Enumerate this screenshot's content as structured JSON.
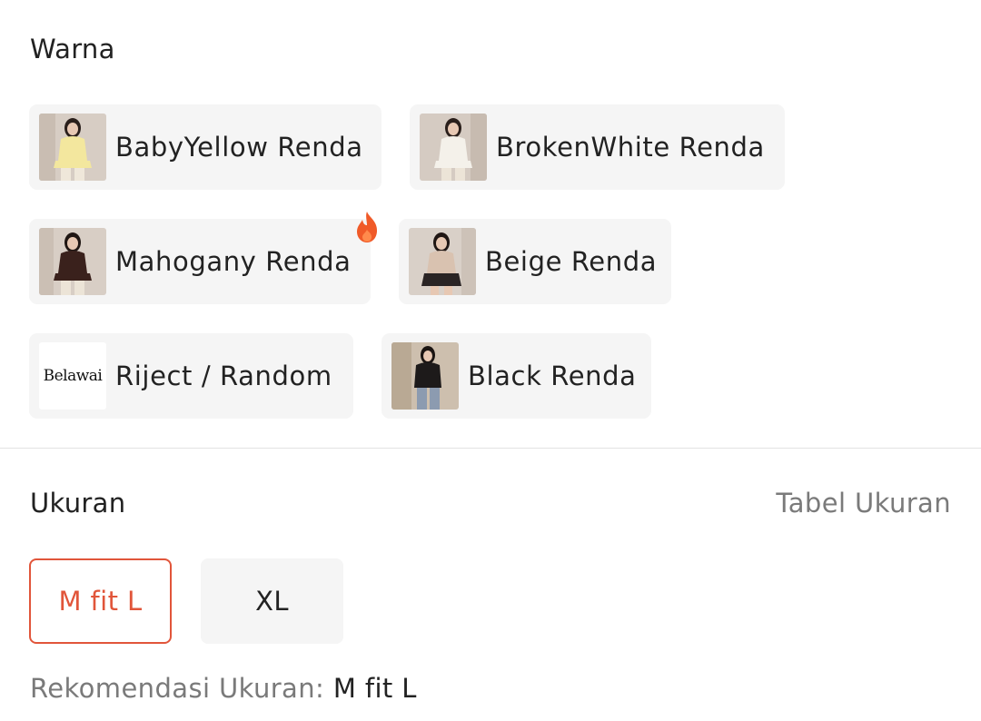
{
  "color_section": {
    "title": "Warna",
    "variants": [
      {
        "label": "BabyYellow Renda",
        "top_color": "#f3e79e",
        "bottom_color": "#efe7da",
        "hot": false
      },
      {
        "label": "BrokenWhite Renda",
        "top_color": "#f4f1ea",
        "bottom_color": "#ece4d7",
        "hot": false
      },
      {
        "label": "Mahogany Renda",
        "top_color": "#3a211c",
        "bottom_color": "#ece4d7",
        "hot": true
      },
      {
        "label": "Beige Renda",
        "top_color": "#d9c2b0",
        "bottom_color": "#2a2424",
        "hot": false
      },
      {
        "label": "Riject / Random",
        "logo_text": "Belawai",
        "hot": false
      },
      {
        "label": "Black Renda",
        "top_color": "#1d1a1a",
        "bottom_color": "#8c9bb0",
        "hot": false
      }
    ]
  },
  "size_section": {
    "title": "Ukuran",
    "size_chart_link": "Tabel Ukuran",
    "sizes": [
      {
        "label": "M fit L",
        "selected": true
      },
      {
        "label": "XL",
        "selected": false
      }
    ],
    "recommendation_label": "Rekomendasi Ukuran:",
    "recommendation_value": "M fit L"
  },
  "colors": {
    "accent": "#e1553a",
    "chip_bg": "#f5f5f5",
    "muted_text": "#7a7a7a",
    "hot_icon": "#f05a28"
  },
  "icons": {
    "hot": "fire-icon"
  }
}
